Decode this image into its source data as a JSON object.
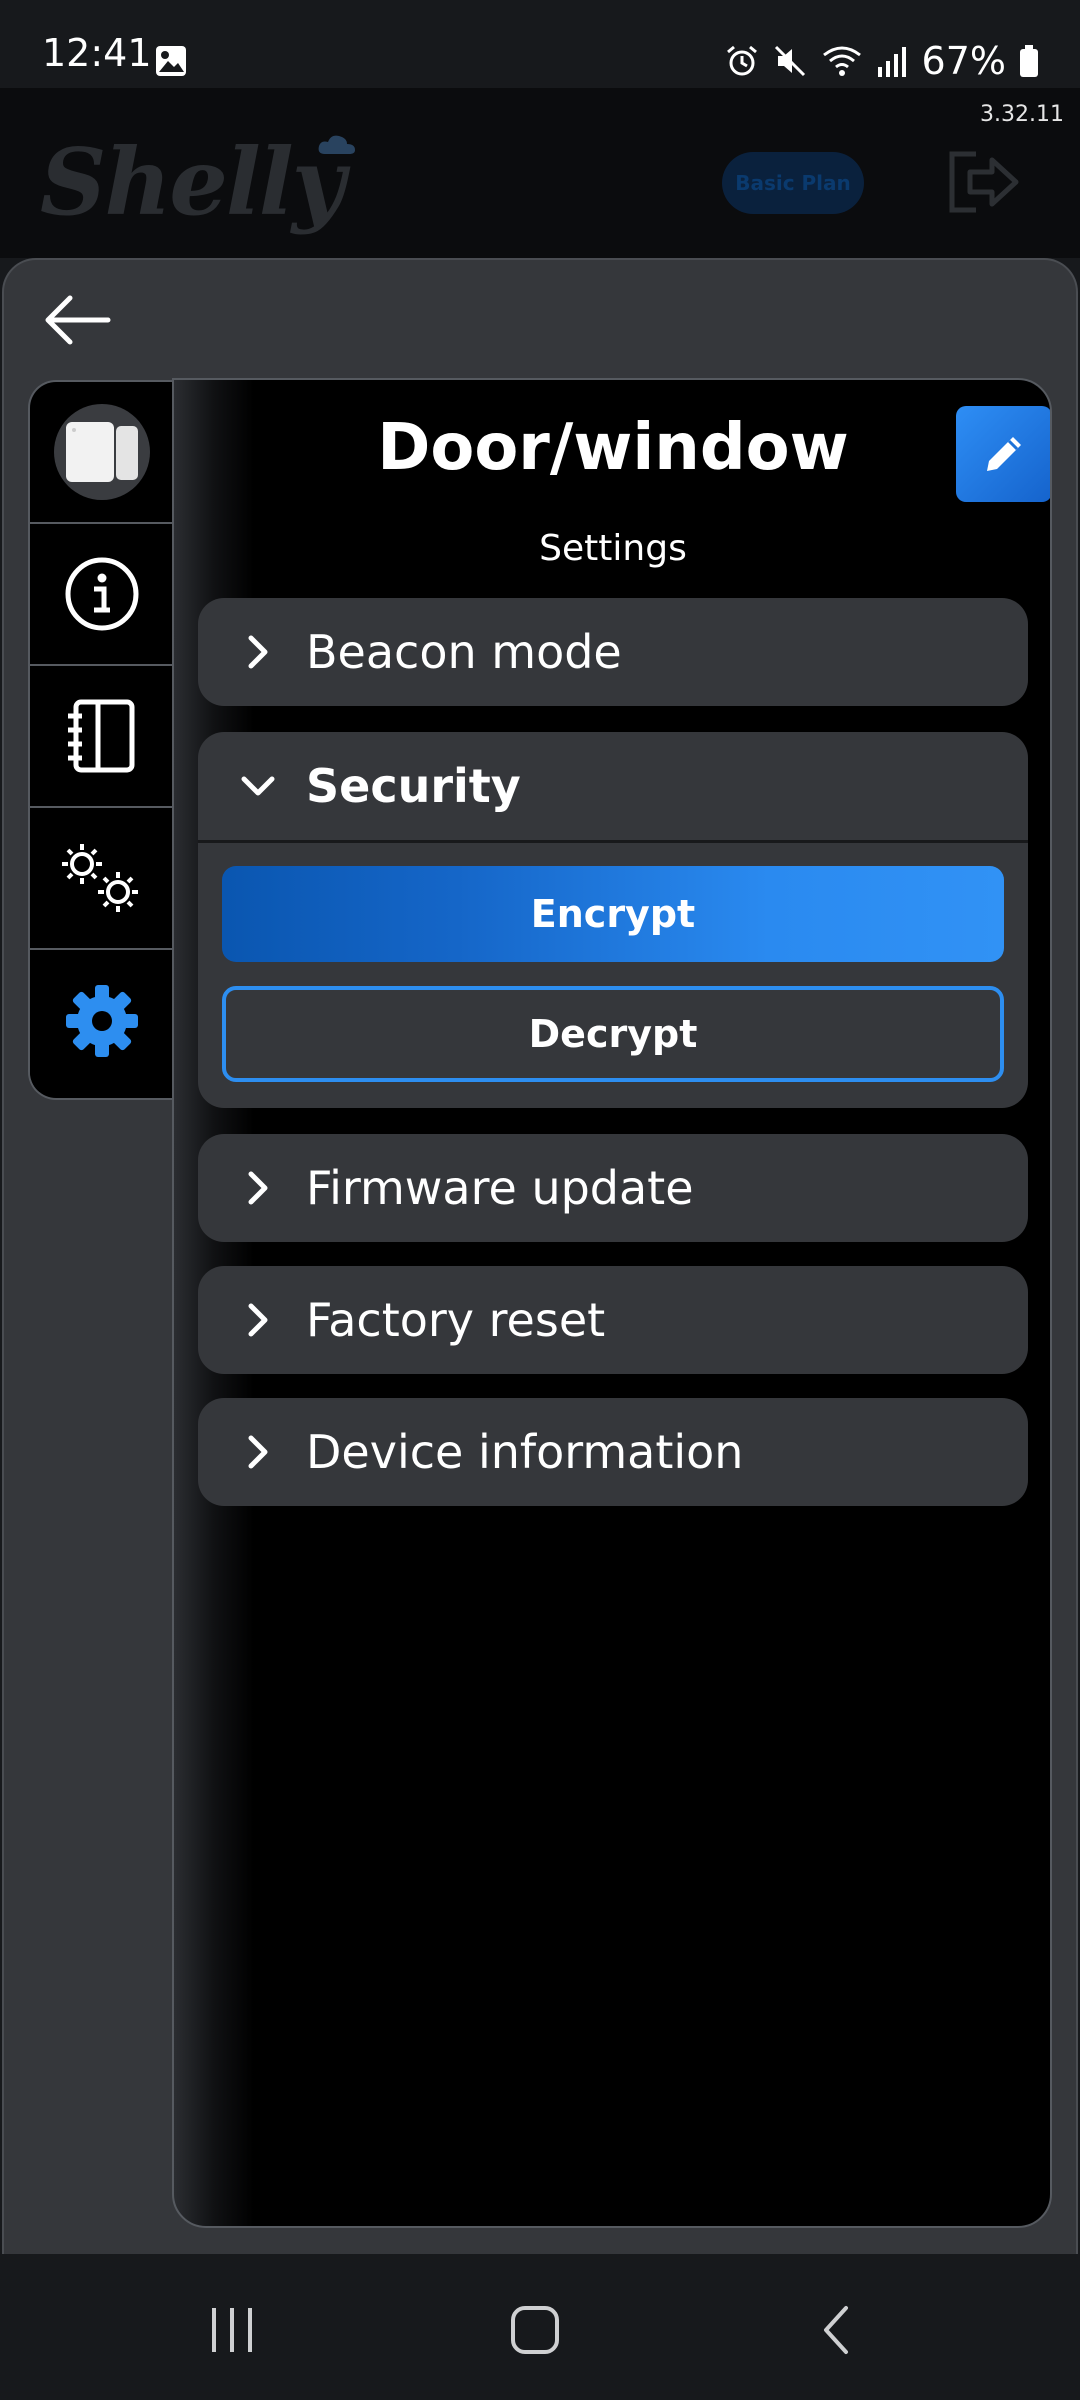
{
  "status_bar": {
    "time": "12:41",
    "battery": "67%",
    "icons": [
      "gallery-icon",
      "alarm-icon",
      "mute-icon",
      "wifi-icon",
      "signal-icon",
      "battery-icon"
    ]
  },
  "app_header": {
    "version": "3.32.11",
    "logo_text": "Shelly",
    "plan_badge": "Basic Plan",
    "logout_icon": "logout-icon"
  },
  "tabs": [
    {
      "name": "device-image",
      "icon": "device-thumbnail",
      "active": false
    },
    {
      "name": "info",
      "icon": "info-icon",
      "active": false
    },
    {
      "name": "log",
      "icon": "notebook-icon",
      "active": false
    },
    {
      "name": "actions",
      "icon": "gears-icon",
      "active": false
    },
    {
      "name": "settings",
      "icon": "gear-icon",
      "active": true
    }
  ],
  "device": {
    "title": "Door/window",
    "subtitle": "Settings"
  },
  "sections": {
    "beacon": "Beacon mode",
    "security": "Security",
    "firmware": "Firmware update",
    "factory": "Factory reset",
    "device_info": "Device information"
  },
  "security": {
    "expanded": true,
    "encrypt_label": "Encrypt",
    "decrypt_label": "Decrypt"
  },
  "colors": {
    "accent": "#2d8ef0",
    "panel": "#35373b",
    "background": "#000000"
  }
}
